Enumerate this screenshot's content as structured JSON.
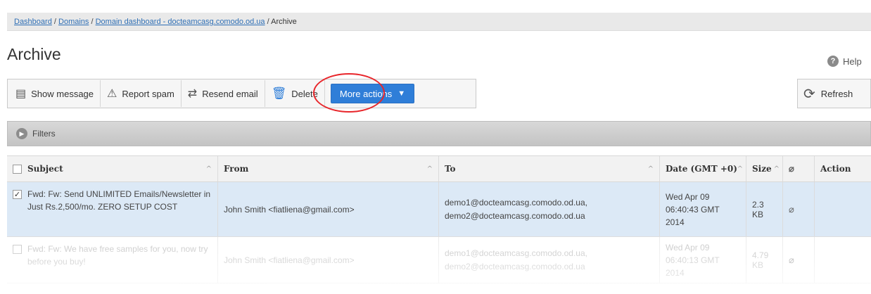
{
  "breadcrumb": {
    "items": [
      "Dashboard",
      "Domains",
      "Domain dashboard - docteamcasg.comodo.od.ua"
    ],
    "current": "Archive",
    "separator": "/"
  },
  "page": {
    "title": "Archive",
    "help_label": "Help"
  },
  "toolbar": {
    "show_message": "Show message",
    "report_spam": "Report spam",
    "resend_email": "Resend email",
    "delete": "Delete",
    "more_actions": "More actions",
    "refresh": "Refresh"
  },
  "filters": {
    "label": "Filters"
  },
  "table": {
    "columns": {
      "subject": "Subject",
      "from": "From",
      "to": "To",
      "date": "Date (GMT +0)",
      "size": "Size",
      "action": "Action"
    },
    "rows": [
      {
        "checked": true,
        "subject": "Fwd: Fw: Send UNLIMITED Emails/Newsletter in Just Rs.2,500/mo. ZERO SETUP COST",
        "from": "John Smith <fiatliena@gmail.com>",
        "to_1": "demo1@docteamcasg.comodo.od.ua,",
        "to_2": "demo2@docteamcasg.comodo.od.ua",
        "date_1": "Wed Apr 09",
        "date_2": "06:40:43 GMT",
        "date_3": "2014",
        "size": "2.3 KB"
      },
      {
        "checked": false,
        "subject": "Fwd: Fw: We have free samples for you, now try before you buy!",
        "from": "John Smith <fiatliena@gmail.com>",
        "to_1": "demo1@docteamcasg.comodo.od.ua,",
        "to_2": "demo2@docteamcasg.comodo.od.ua",
        "date_1": "Wed Apr 09",
        "date_2": "06:40:13 GMT",
        "date_3": "2014",
        "size": "4.79 KB"
      }
    ]
  },
  "colors": {
    "accent": "#2f7ed8",
    "highlight_ring": "#e8262b",
    "selected_row": "#dce9f6"
  },
  "icons": {
    "show_message": "message-icon",
    "report_spam": "warning-icon",
    "resend": "resend-icon",
    "delete": "trash-icon",
    "refresh": "refresh-icon",
    "help": "question-icon",
    "filters": "expand-icon",
    "attachment": "paperclip-icon"
  }
}
